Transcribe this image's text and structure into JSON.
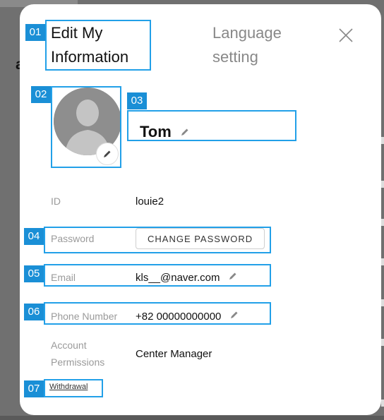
{
  "modal": {
    "tab_edit_line1": "Edit My",
    "tab_edit_line2": "Information",
    "tab_lang_line1": "Language",
    "tab_lang_line2": "setting",
    "close_icon": "close-icon"
  },
  "profile": {
    "name": "Tom",
    "avatar_icon": "person-silhouette",
    "edit_icon": "pencil-icon"
  },
  "fields": {
    "id_label": "ID",
    "id_value": "louie2",
    "password_label": "Password",
    "password_button": "CHANGE PASSWORD",
    "email_label": "Email",
    "email_value": "kls__@naver.com",
    "phone_label": "Phone Number",
    "phone_value": "+82 00000000000",
    "permissions_label_line1": "Account",
    "permissions_label_line2": "Permissions",
    "permissions_value": "Center Manager"
  },
  "withdrawal": "Withdrawal",
  "annotations": [
    "01",
    "02",
    "03",
    "04",
    "05",
    "06",
    "07"
  ],
  "background": {
    "fragment": "ab"
  },
  "colors": {
    "annotation": "#1a8fd6",
    "modal_bg": "#ffffff",
    "overlay": "#707070"
  }
}
